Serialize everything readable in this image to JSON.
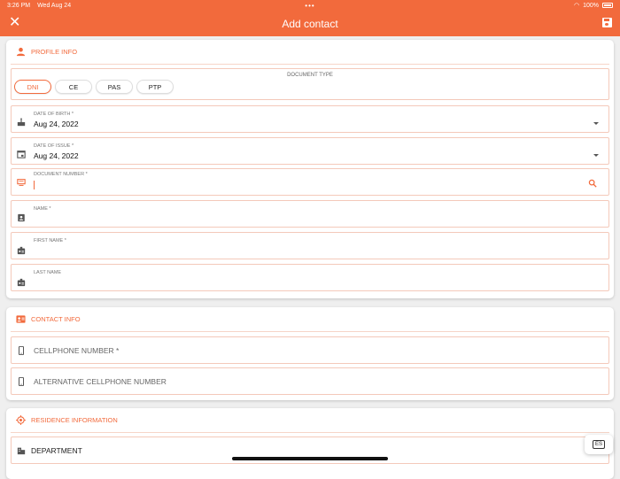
{
  "status": {
    "time": "3:26 PM",
    "date": "Wed Aug 24",
    "battery": "100%"
  },
  "appbar": {
    "title": "Add contact"
  },
  "profile": {
    "section_title": "PROFILE INFO",
    "doc_type_label": "DOCUMENT TYPE",
    "doc_types": [
      "DNI",
      "CE",
      "PAS",
      "PTP"
    ],
    "selected_doc_type": "DNI",
    "birth_label": "DATE OF BIRTH *",
    "birth_value": "Aug 24, 2022",
    "issue_label": "DATE OF ISSUE *",
    "issue_value": "Aug 24, 2022",
    "doc_number_label": "DOCUMENT NUMBER *",
    "name_label": "NAME *",
    "first_name_label": "FIRST NAME *",
    "last_name_label": "LAST NAME"
  },
  "contact": {
    "section_title": "CONTACT INFO",
    "cellphone_placeholder": "CELLPHONE NUMBER *",
    "alt_cellphone_placeholder": "ALTERNATIVE CELLPHONE NUMBER"
  },
  "residence": {
    "section_title": "RESIDENCE INFORMATION",
    "department_placeholder": "DEPARTMENT"
  },
  "keyboard": {
    "language": "ES"
  },
  "colors": {
    "accent": "#f26a3c",
    "border": "#f4c9ba",
    "background": "#efefef"
  }
}
